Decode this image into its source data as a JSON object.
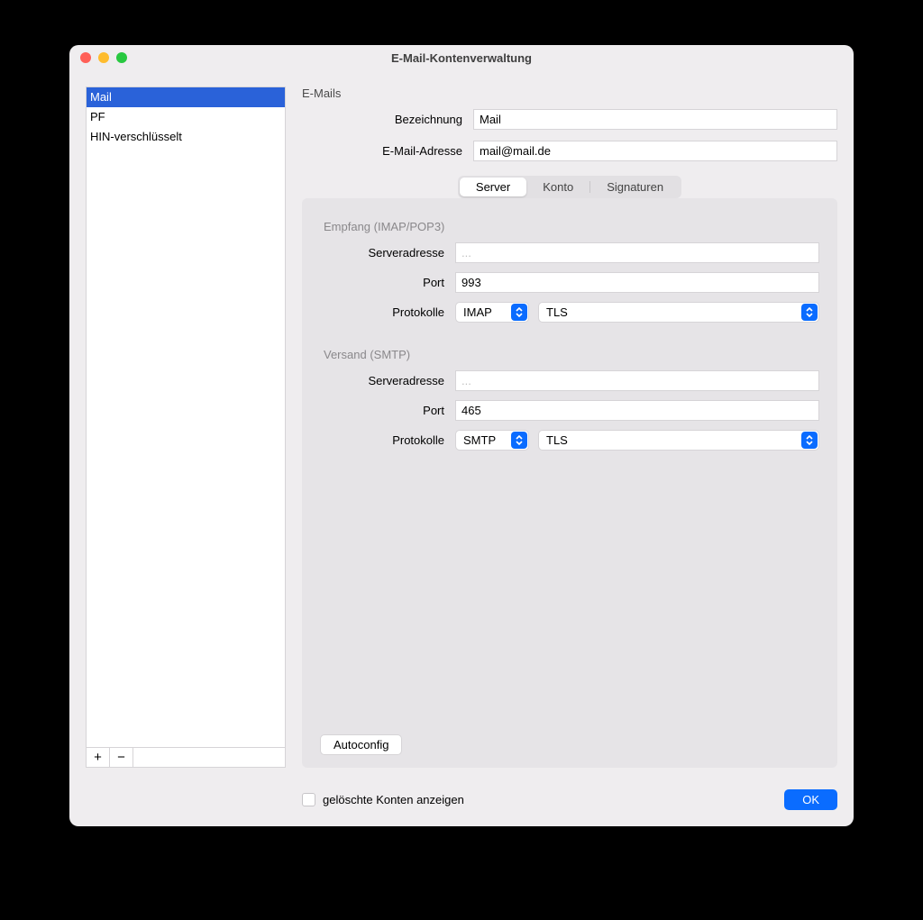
{
  "window": {
    "title": "E-Mail-Kontenverwaltung"
  },
  "sidebar": {
    "accounts": [
      {
        "label": "Mail",
        "selected": true
      },
      {
        "label": "PF",
        "selected": false
      },
      {
        "label": "HIN-verschlüsselt",
        "selected": false
      }
    ],
    "add_glyph": "+",
    "remove_glyph": "−"
  },
  "main": {
    "section_heading": "E-Mails",
    "fields": {
      "bezeichnung_label": "Bezeichnung",
      "bezeichnung_value": "Mail",
      "email_label": "E-Mail-Adresse",
      "email_value": "mail@mail.de"
    },
    "tabs": {
      "server": "Server",
      "konto": "Konto",
      "signaturen": "Signaturen"
    },
    "incoming": {
      "heading": "Empfang (IMAP/POP3)",
      "serveradresse_label": "Serveradresse",
      "serveradresse_placeholder": "...",
      "port_label": "Port",
      "port_value": "993",
      "protokolle_label": "Protokolle",
      "protocol_value": "IMAP",
      "encryption_value": "TLS"
    },
    "outgoing": {
      "heading": "Versand (SMTP)",
      "serveradresse_label": "Serveradresse",
      "serveradresse_placeholder": "...",
      "port_label": "Port",
      "port_value": "465",
      "protokolle_label": "Protokolle",
      "protocol_value": "SMTP",
      "encryption_value": "TLS"
    },
    "autoconfig_label": "Autoconfig"
  },
  "footer": {
    "show_deleted_label": "gelöschte Konten anzeigen",
    "ok_label": "OK"
  }
}
